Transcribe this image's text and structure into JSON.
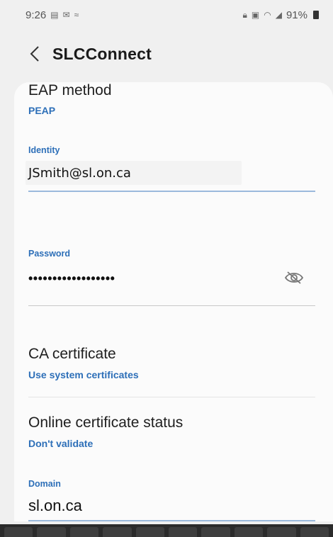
{
  "status_bar": {
    "time": "9:26",
    "left_icons": [
      "message-icon",
      "mail-icon",
      "cast-icon"
    ],
    "right_icons": [
      "lock-icon",
      "vibrate-icon",
      "wifi-icon",
      "signal-icon"
    ],
    "battery": "91%"
  },
  "app_bar": {
    "title": "SLCConnect"
  },
  "eap": {
    "title": "EAP method",
    "value": "PEAP"
  },
  "identity": {
    "label": "Identity",
    "value": "JSmith@sl.on.ca"
  },
  "password": {
    "label": "Password",
    "value": "••••••••••••••••••"
  },
  "ca_certificate": {
    "title": "CA certificate",
    "value": "Use system certificates"
  },
  "online_status": {
    "title": "Online certificate status",
    "value": "Don't validate"
  },
  "domain": {
    "label": "Domain",
    "value": "sl.on.ca"
  },
  "colors": {
    "accent": "#2d6fb8",
    "background": "#f0f0f0",
    "card": "#fbfbfb"
  }
}
